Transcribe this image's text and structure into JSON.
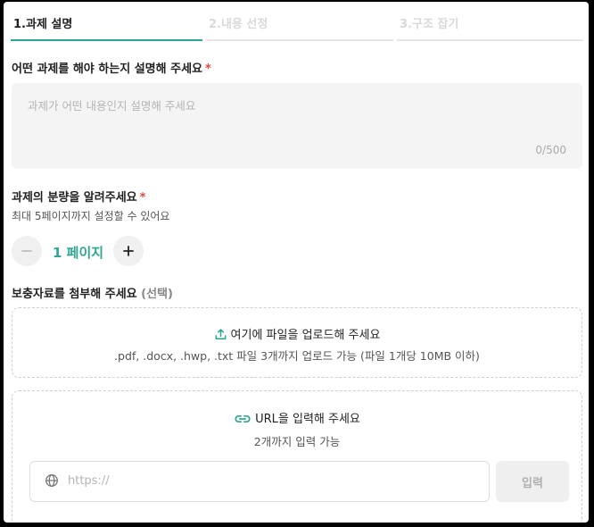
{
  "tabs": [
    {
      "label": "1.과제 설명"
    },
    {
      "label": "2.내용 선정"
    },
    {
      "label": "3.구조 잡기"
    }
  ],
  "description": {
    "question": "어떤 과제를 해야 하는지 설명해 주세요",
    "required_mark": "*",
    "placeholder": "과제가 어떤 내용인지 설명해 주세요",
    "counter": "0/500"
  },
  "volume": {
    "question": "과제의 분량을 알려주세요",
    "required_mark": "*",
    "hint": "최대 5페이지까지 설정할 수 있어요",
    "value": "1 페이지"
  },
  "attachments": {
    "question": "보충자료를 첨부해 주세요",
    "optional_note": "(선택)",
    "upload": {
      "title": "여기에 파일을 업로드해 주세요",
      "desc": ".pdf, .docx, .hwp, .txt 파일 3개까지 업로드 가능 (파일 1개당 10MB 이하)"
    },
    "url": {
      "title": "URL을 입력해 주세요",
      "desc": "2개까지 입력 가능",
      "placeholder": "https://",
      "submit_label": "입력"
    }
  },
  "colors": {
    "accent": "#2ea591",
    "required": "#e5483a"
  }
}
